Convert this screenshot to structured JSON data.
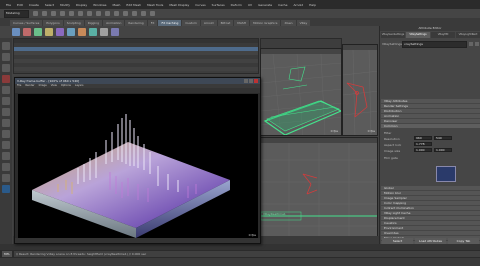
{
  "menubar": {
    "items": [
      "File",
      "Edit",
      "Create",
      "Select",
      "Modify",
      "Display",
      "Windows",
      "Mesh",
      "Edit Mesh",
      "Mesh Tools",
      "Mesh Display",
      "Curves",
      "Surfaces",
      "Deform",
      "UV",
      "Generate",
      "Cache",
      "Arnold",
      "Help"
    ]
  },
  "status": {
    "mode": "Modeling"
  },
  "shelf": {
    "tabs": [
      "Curves / Surfaces",
      "Polygons",
      "Sculpting",
      "Rigging",
      "Animation",
      "Rendering",
      "FX",
      "FX Caching",
      "Custom",
      "Arnold",
      "Bifrost",
      "MASH",
      "Motion Graphics",
      "XGen",
      "VRay"
    ],
    "active_index": 7
  },
  "viewports": {
    "top_fps": "0 fps",
    "right_fps": "0 fps",
    "bottom_fps": "0 fps",
    "bottom_label": "VRayRealtime1"
  },
  "vfb": {
    "title": "V-Ray frame buffer - [100% of 960 x 540]",
    "menu": [
      "File",
      "Render",
      "Image",
      "View",
      "Options",
      "Layers"
    ],
    "fps": "0 fps"
  },
  "attribute_editor": {
    "title": "Attribute Editor",
    "tabs": [
      "VRayGeoSettings",
      "VRaySettings",
      "VRayMtl",
      "VRayLightRect"
    ],
    "node_label": "VRaySettings:",
    "node_value": "vraySettings",
    "sections_closed_top": [
      "VRay Attributes",
      "Render Settings",
      "Distribution",
      "Animation",
      "Denoiser"
    ],
    "open_section": "Common",
    "subsections": [
      "Filter",
      "Resolution",
      "Aspect lock",
      "Image size",
      "Film gate"
    ],
    "values": [
      "960",
      "540",
      "1.778",
      "1.000",
      "1.000"
    ],
    "sections_closed_bottom": [
      "Global",
      "Motion blur",
      "Image Sampler",
      "Color mapping",
      "Indirect illumination",
      "VRay Light Cache",
      "Displacement",
      "Caustics",
      "Environment",
      "Overrides",
      "Maya Globals",
      "Node Behavior",
      "Extra Attributes"
    ],
    "buttons": [
      "Select",
      "Load Attributes",
      "Copy Tab"
    ]
  },
  "command": {
    "label": "MEL",
    "result": "// Result: Rendering V-Ray scene on 8 threads: heightfield (vrayRealtime1) // 0.000 sec"
  }
}
